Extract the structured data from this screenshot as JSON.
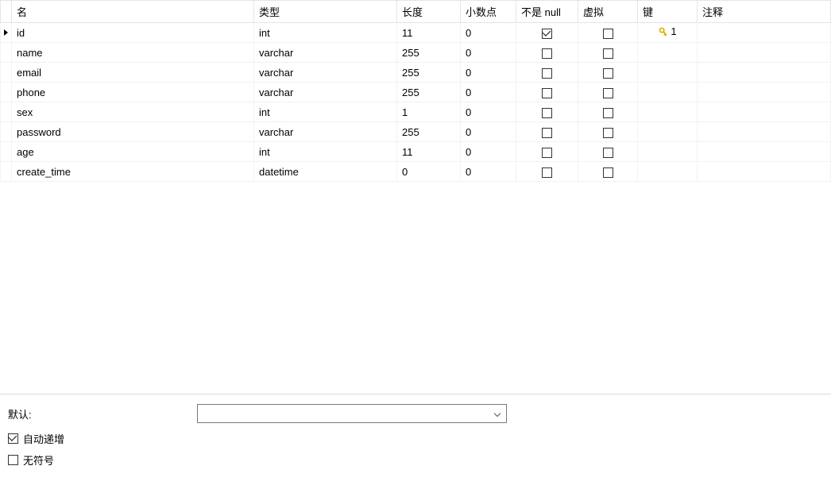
{
  "columns": {
    "name": "名",
    "type": "类型",
    "length": "长度",
    "decimal": "小数点",
    "notnull": "不是 null",
    "virtual": "虚拟",
    "key": "键",
    "comment": "注释"
  },
  "rows": [
    {
      "name": "id",
      "type": "int",
      "length": "11",
      "decimal": "0",
      "notnull": true,
      "virtual": false,
      "key": "1",
      "is_key": true,
      "comment": "",
      "selected": true
    },
    {
      "name": "name",
      "type": "varchar",
      "length": "255",
      "decimal": "0",
      "notnull": false,
      "virtual": false,
      "key": "",
      "is_key": false,
      "comment": "",
      "selected": false
    },
    {
      "name": "email",
      "type": "varchar",
      "length": "255",
      "decimal": "0",
      "notnull": false,
      "virtual": false,
      "key": "",
      "is_key": false,
      "comment": "",
      "selected": false
    },
    {
      "name": "phone",
      "type": "varchar",
      "length": "255",
      "decimal": "0",
      "notnull": false,
      "virtual": false,
      "key": "",
      "is_key": false,
      "comment": "",
      "selected": false
    },
    {
      "name": "sex",
      "type": "int",
      "length": "1",
      "decimal": "0",
      "notnull": false,
      "virtual": false,
      "key": "",
      "is_key": false,
      "comment": "",
      "selected": false
    },
    {
      "name": "password",
      "type": "varchar",
      "length": "255",
      "decimal": "0",
      "notnull": false,
      "virtual": false,
      "key": "",
      "is_key": false,
      "comment": "",
      "selected": false
    },
    {
      "name": "age",
      "type": "int",
      "length": "11",
      "decimal": "0",
      "notnull": false,
      "virtual": false,
      "key": "",
      "is_key": false,
      "comment": "",
      "selected": false
    },
    {
      "name": "create_time",
      "type": "datetime",
      "length": "0",
      "decimal": "0",
      "notnull": false,
      "virtual": false,
      "key": "",
      "is_key": false,
      "comment": "",
      "selected": false
    }
  ],
  "bottom": {
    "default_label": "默认:",
    "default_value": "",
    "auto_increment_label": "自动递增",
    "auto_increment_checked": true,
    "unsigned_label": "无符号",
    "unsigned_checked": false
  }
}
